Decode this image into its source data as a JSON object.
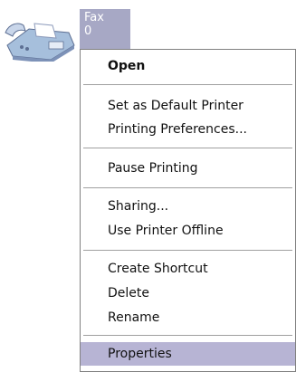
{
  "printer": {
    "name": "Fax",
    "status": "0",
    "icon": "fax-printer-icon"
  },
  "context_menu": {
    "items": [
      {
        "label": "Open",
        "bold": true
      },
      {
        "label": "Set as Default Printer"
      },
      {
        "label": "Printing Preferences..."
      },
      {
        "label": "Pause Printing"
      },
      {
        "label": "Sharing..."
      },
      {
        "label": "Use Printer Offline"
      },
      {
        "label": "Create Shortcut"
      },
      {
        "label": "Delete"
      },
      {
        "label": "Rename"
      },
      {
        "label": "Properties",
        "selected": true
      }
    ]
  },
  "colors": {
    "selection_bg": "#b7b4d4",
    "label_bg": "#a7a8c5"
  }
}
